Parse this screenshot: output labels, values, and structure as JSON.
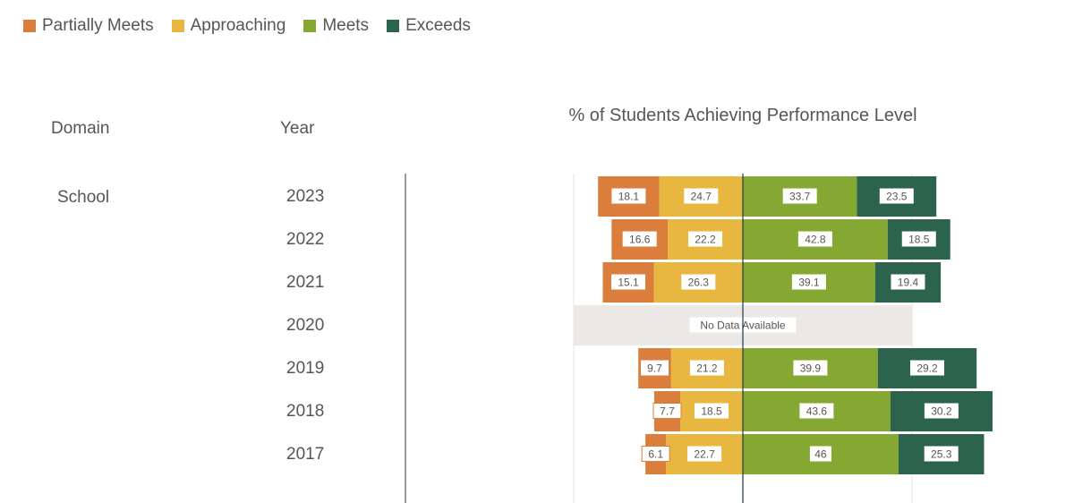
{
  "legend": [
    {
      "label": "Partially Meets",
      "color": "#DB7E3B"
    },
    {
      "label": "Approaching",
      "color": "#E8B740"
    },
    {
      "label": "Meets",
      "color": "#85A833"
    },
    {
      "label": "Exceeds",
      "color": "#2B634D"
    }
  ],
  "headers": {
    "domain": "Domain",
    "year": "Year",
    "chart_title": "% of Students Achieving Performance Level"
  },
  "domain_label": "School",
  "no_data_text": "No Data Available",
  "chart_data": {
    "type": "bar",
    "orientation": "horizontal",
    "stacked": "diverging",
    "title": "% of Students Achieving Performance Level",
    "categories": [
      "2023",
      "2022",
      "2021",
      "2020",
      "2019",
      "2018",
      "2017"
    ],
    "domain": "School",
    "series": [
      {
        "name": "Partially Meets",
        "side": "negative",
        "color": "#DB7E3B",
        "values": [
          18.1,
          16.6,
          15.1,
          null,
          9.7,
          7.7,
          6.1
        ]
      },
      {
        "name": "Approaching",
        "side": "negative",
        "color": "#E8B740",
        "values": [
          24.7,
          22.2,
          26.3,
          null,
          21.2,
          18.5,
          22.7
        ]
      },
      {
        "name": "Meets",
        "side": "positive",
        "color": "#85A833",
        "values": [
          33.7,
          42.8,
          39.1,
          null,
          39.9,
          43.6,
          46
        ]
      },
      {
        "name": "Exceeds",
        "side": "positive",
        "color": "#2B634D",
        "values": [
          23.5,
          18.5,
          19.4,
          null,
          29.2,
          30.2,
          25.3
        ]
      }
    ],
    "missing": {
      "2020": "No Data Available"
    },
    "xlim": [
      -50,
      80
    ],
    "gridlines": [
      -50,
      0,
      50
    ],
    "legend_position": "top-left",
    "xlabel": "",
    "ylabel": ""
  }
}
